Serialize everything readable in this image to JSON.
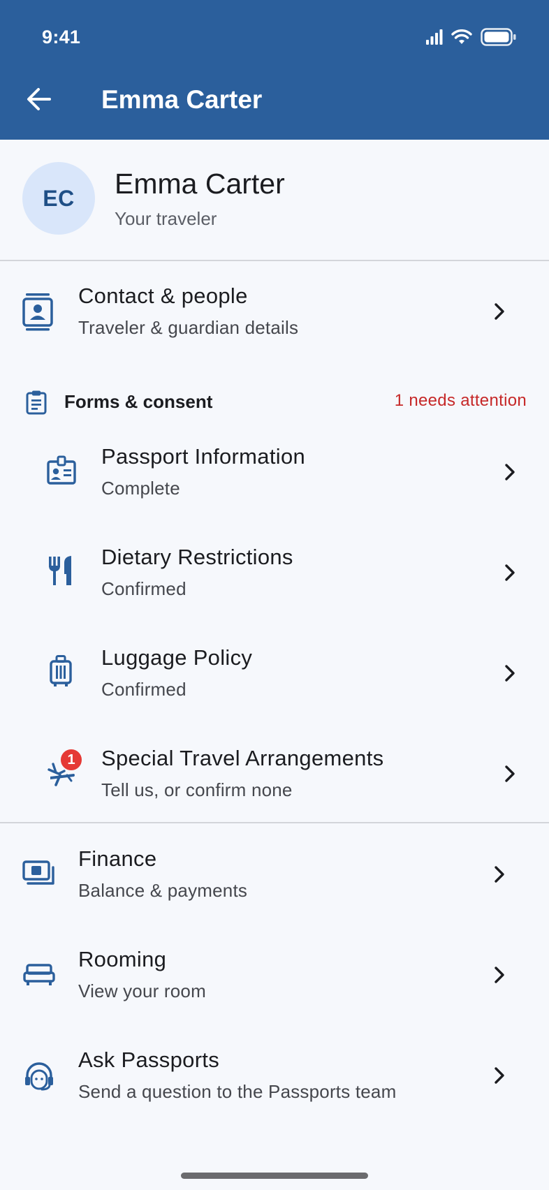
{
  "status_bar": {
    "time": "9:41"
  },
  "header": {
    "title": "Emma Carter",
    "back_icon": "arrow-left-icon"
  },
  "profile": {
    "initials": "EC",
    "name": "Emma Carter",
    "subtitle": "Your traveler"
  },
  "contact": {
    "title": "Contact & people",
    "subtitle": "Traveler & guardian details",
    "icon": "contact-card-icon"
  },
  "forms_section": {
    "title": "Forms & consent",
    "alert": "1 needs attention",
    "icon": "clipboard-icon",
    "items": [
      {
        "title": "Passport Information",
        "subtitle": "Complete",
        "icon": "id-badge-icon"
      },
      {
        "title": "Dietary Restrictions",
        "subtitle": "Confirmed",
        "icon": "utensils-icon"
      },
      {
        "title": "Luggage Policy",
        "subtitle": "Confirmed",
        "icon": "suitcase-icon"
      },
      {
        "title": "Special Travel Arrangements",
        "subtitle": "Tell us, or confirm none",
        "icon": "plane-arrangements-icon",
        "badge": "1"
      }
    ]
  },
  "more": [
    {
      "title": "Finance",
      "subtitle": "Balance & payments",
      "icon": "payments-icon"
    },
    {
      "title": "Rooming",
      "subtitle": "View your room",
      "icon": "bed-icon"
    },
    {
      "title": "Ask Passports",
      "subtitle": "Send a question to the Passports team",
      "icon": "support-agent-icon"
    }
  ],
  "colors": {
    "header": "#2b5f9c",
    "icon": "#2b5f9c",
    "alert": "#c62828",
    "badge": "#e53935",
    "avatar_bg": "#d9e6fa"
  }
}
